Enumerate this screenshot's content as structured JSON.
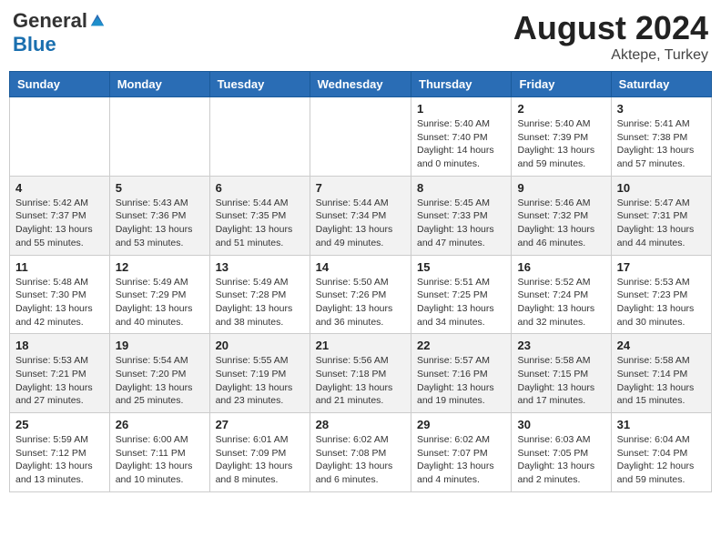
{
  "header": {
    "logo_general": "General",
    "logo_blue": "Blue",
    "month": "August 2024",
    "location": "Aktepe, Turkey"
  },
  "days_of_week": [
    "Sunday",
    "Monday",
    "Tuesday",
    "Wednesday",
    "Thursday",
    "Friday",
    "Saturday"
  ],
  "weeks": [
    [
      {
        "day": "",
        "info": ""
      },
      {
        "day": "",
        "info": ""
      },
      {
        "day": "",
        "info": ""
      },
      {
        "day": "",
        "info": ""
      },
      {
        "day": "1",
        "info": "Sunrise: 5:40 AM\nSunset: 7:40 PM\nDaylight: 14 hours\nand 0 minutes."
      },
      {
        "day": "2",
        "info": "Sunrise: 5:40 AM\nSunset: 7:39 PM\nDaylight: 13 hours\nand 59 minutes."
      },
      {
        "day": "3",
        "info": "Sunrise: 5:41 AM\nSunset: 7:38 PM\nDaylight: 13 hours\nand 57 minutes."
      }
    ],
    [
      {
        "day": "4",
        "info": "Sunrise: 5:42 AM\nSunset: 7:37 PM\nDaylight: 13 hours\nand 55 minutes."
      },
      {
        "day": "5",
        "info": "Sunrise: 5:43 AM\nSunset: 7:36 PM\nDaylight: 13 hours\nand 53 minutes."
      },
      {
        "day": "6",
        "info": "Sunrise: 5:44 AM\nSunset: 7:35 PM\nDaylight: 13 hours\nand 51 minutes."
      },
      {
        "day": "7",
        "info": "Sunrise: 5:44 AM\nSunset: 7:34 PM\nDaylight: 13 hours\nand 49 minutes."
      },
      {
        "day": "8",
        "info": "Sunrise: 5:45 AM\nSunset: 7:33 PM\nDaylight: 13 hours\nand 47 minutes."
      },
      {
        "day": "9",
        "info": "Sunrise: 5:46 AM\nSunset: 7:32 PM\nDaylight: 13 hours\nand 46 minutes."
      },
      {
        "day": "10",
        "info": "Sunrise: 5:47 AM\nSunset: 7:31 PM\nDaylight: 13 hours\nand 44 minutes."
      }
    ],
    [
      {
        "day": "11",
        "info": "Sunrise: 5:48 AM\nSunset: 7:30 PM\nDaylight: 13 hours\nand 42 minutes."
      },
      {
        "day": "12",
        "info": "Sunrise: 5:49 AM\nSunset: 7:29 PM\nDaylight: 13 hours\nand 40 minutes."
      },
      {
        "day": "13",
        "info": "Sunrise: 5:49 AM\nSunset: 7:28 PM\nDaylight: 13 hours\nand 38 minutes."
      },
      {
        "day": "14",
        "info": "Sunrise: 5:50 AM\nSunset: 7:26 PM\nDaylight: 13 hours\nand 36 minutes."
      },
      {
        "day": "15",
        "info": "Sunrise: 5:51 AM\nSunset: 7:25 PM\nDaylight: 13 hours\nand 34 minutes."
      },
      {
        "day": "16",
        "info": "Sunrise: 5:52 AM\nSunset: 7:24 PM\nDaylight: 13 hours\nand 32 minutes."
      },
      {
        "day": "17",
        "info": "Sunrise: 5:53 AM\nSunset: 7:23 PM\nDaylight: 13 hours\nand 30 minutes."
      }
    ],
    [
      {
        "day": "18",
        "info": "Sunrise: 5:53 AM\nSunset: 7:21 PM\nDaylight: 13 hours\nand 27 minutes."
      },
      {
        "day": "19",
        "info": "Sunrise: 5:54 AM\nSunset: 7:20 PM\nDaylight: 13 hours\nand 25 minutes."
      },
      {
        "day": "20",
        "info": "Sunrise: 5:55 AM\nSunset: 7:19 PM\nDaylight: 13 hours\nand 23 minutes."
      },
      {
        "day": "21",
        "info": "Sunrise: 5:56 AM\nSunset: 7:18 PM\nDaylight: 13 hours\nand 21 minutes."
      },
      {
        "day": "22",
        "info": "Sunrise: 5:57 AM\nSunset: 7:16 PM\nDaylight: 13 hours\nand 19 minutes."
      },
      {
        "day": "23",
        "info": "Sunrise: 5:58 AM\nSunset: 7:15 PM\nDaylight: 13 hours\nand 17 minutes."
      },
      {
        "day": "24",
        "info": "Sunrise: 5:58 AM\nSunset: 7:14 PM\nDaylight: 13 hours\nand 15 minutes."
      }
    ],
    [
      {
        "day": "25",
        "info": "Sunrise: 5:59 AM\nSunset: 7:12 PM\nDaylight: 13 hours\nand 13 minutes."
      },
      {
        "day": "26",
        "info": "Sunrise: 6:00 AM\nSunset: 7:11 PM\nDaylight: 13 hours\nand 10 minutes."
      },
      {
        "day": "27",
        "info": "Sunrise: 6:01 AM\nSunset: 7:09 PM\nDaylight: 13 hours\nand 8 minutes."
      },
      {
        "day": "28",
        "info": "Sunrise: 6:02 AM\nSunset: 7:08 PM\nDaylight: 13 hours\nand 6 minutes."
      },
      {
        "day": "29",
        "info": "Sunrise: 6:02 AM\nSunset: 7:07 PM\nDaylight: 13 hours\nand 4 minutes."
      },
      {
        "day": "30",
        "info": "Sunrise: 6:03 AM\nSunset: 7:05 PM\nDaylight: 13 hours\nand 2 minutes."
      },
      {
        "day": "31",
        "info": "Sunrise: 6:04 AM\nSunset: 7:04 PM\nDaylight: 12 hours\nand 59 minutes."
      }
    ]
  ]
}
